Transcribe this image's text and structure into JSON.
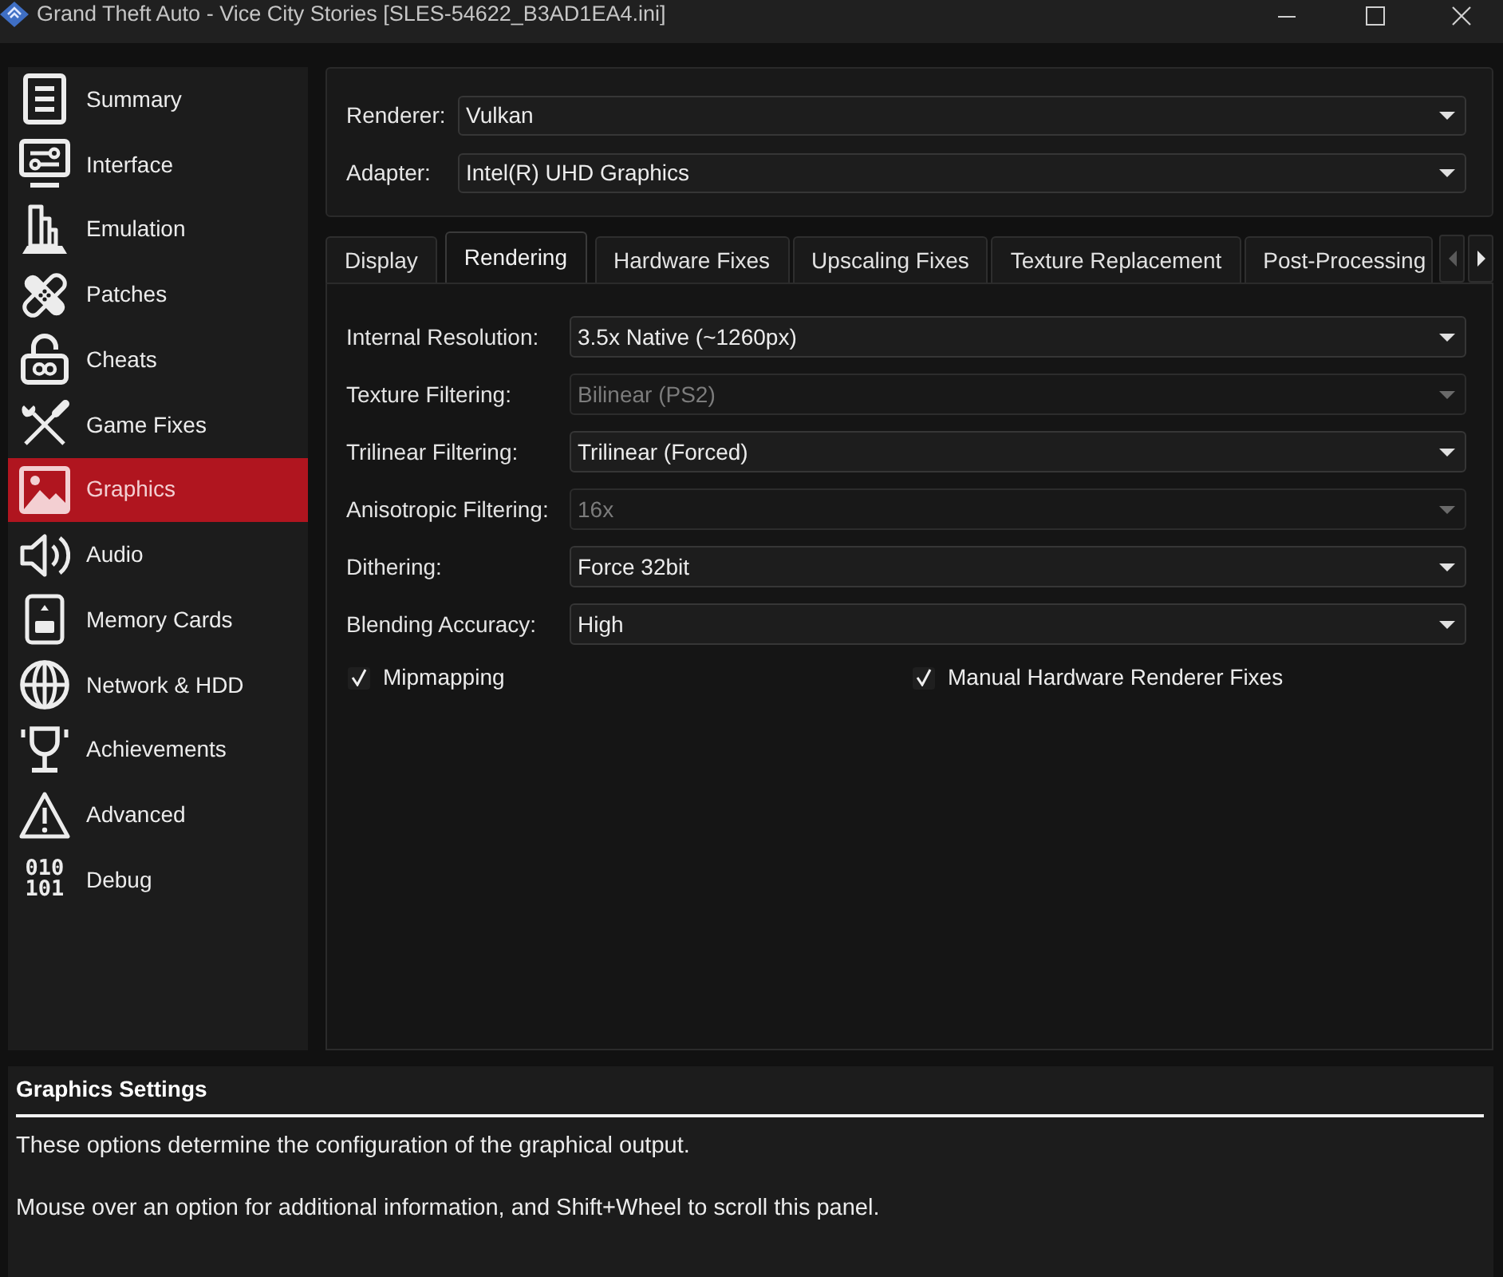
{
  "window": {
    "title": "Grand Theft Auto - Vice City Stories [SLES-54622_B3AD1EA4.ini]"
  },
  "sidebar": {
    "items": [
      {
        "label": "Summary",
        "selected": false
      },
      {
        "label": "Interface",
        "selected": false
      },
      {
        "label": "Emulation",
        "selected": false
      },
      {
        "label": "Patches",
        "selected": false
      },
      {
        "label": "Cheats",
        "selected": false
      },
      {
        "label": "Game Fixes",
        "selected": false
      },
      {
        "label": "Graphics",
        "selected": true
      },
      {
        "label": "Audio",
        "selected": false
      },
      {
        "label": "Memory Cards",
        "selected": false
      },
      {
        "label": "Network & HDD",
        "selected": false
      },
      {
        "label": "Achievements",
        "selected": false
      },
      {
        "label": "Advanced",
        "selected": false
      },
      {
        "label": "Debug",
        "selected": false,
        "glyph": "010 101"
      }
    ]
  },
  "renderer_box": {
    "fields": [
      {
        "label": "Renderer:",
        "value": "Vulkan"
      },
      {
        "label": "Adapter:",
        "value": "Intel(R) UHD Graphics"
      }
    ]
  },
  "tabs": [
    {
      "label": "Display",
      "selected": false
    },
    {
      "label": "Rendering",
      "selected": true
    },
    {
      "label": "Hardware Fixes",
      "selected": false
    },
    {
      "label": "Upscaling Fixes",
      "selected": false
    },
    {
      "label": "Texture Replacement",
      "selected": false
    },
    {
      "label": "Post-Processing",
      "selected": false
    }
  ],
  "tab_scroll": {
    "left_disabled": true,
    "right_disabled": false
  },
  "settings": {
    "rows": [
      {
        "label": "Internal Resolution:",
        "value": "3.5x Native (~1260px)",
        "disabled": false
      },
      {
        "label": "Texture Filtering:",
        "value": "Bilinear (PS2)",
        "disabled": true
      },
      {
        "label": "Trilinear Filtering:",
        "value": "Trilinear (Forced)",
        "disabled": false
      },
      {
        "label": "Anisotropic Filtering:",
        "value": "16x",
        "disabled": true
      },
      {
        "label": "Dithering:",
        "value": "Force 32bit",
        "disabled": false
      },
      {
        "label": "Blending Accuracy:",
        "value": "High",
        "disabled": false
      }
    ],
    "checkboxes": [
      {
        "label": "Mipmapping",
        "checked": true
      },
      {
        "label": "Manual Hardware Renderer Fixes",
        "checked": true
      }
    ]
  },
  "info_panel": {
    "title": "Graphics Settings",
    "paragraphs": [
      "These options determine the configuration of the graphical output.",
      "Mouse over an option for additional information, and Shift+Wheel to scroll this panel."
    ]
  }
}
